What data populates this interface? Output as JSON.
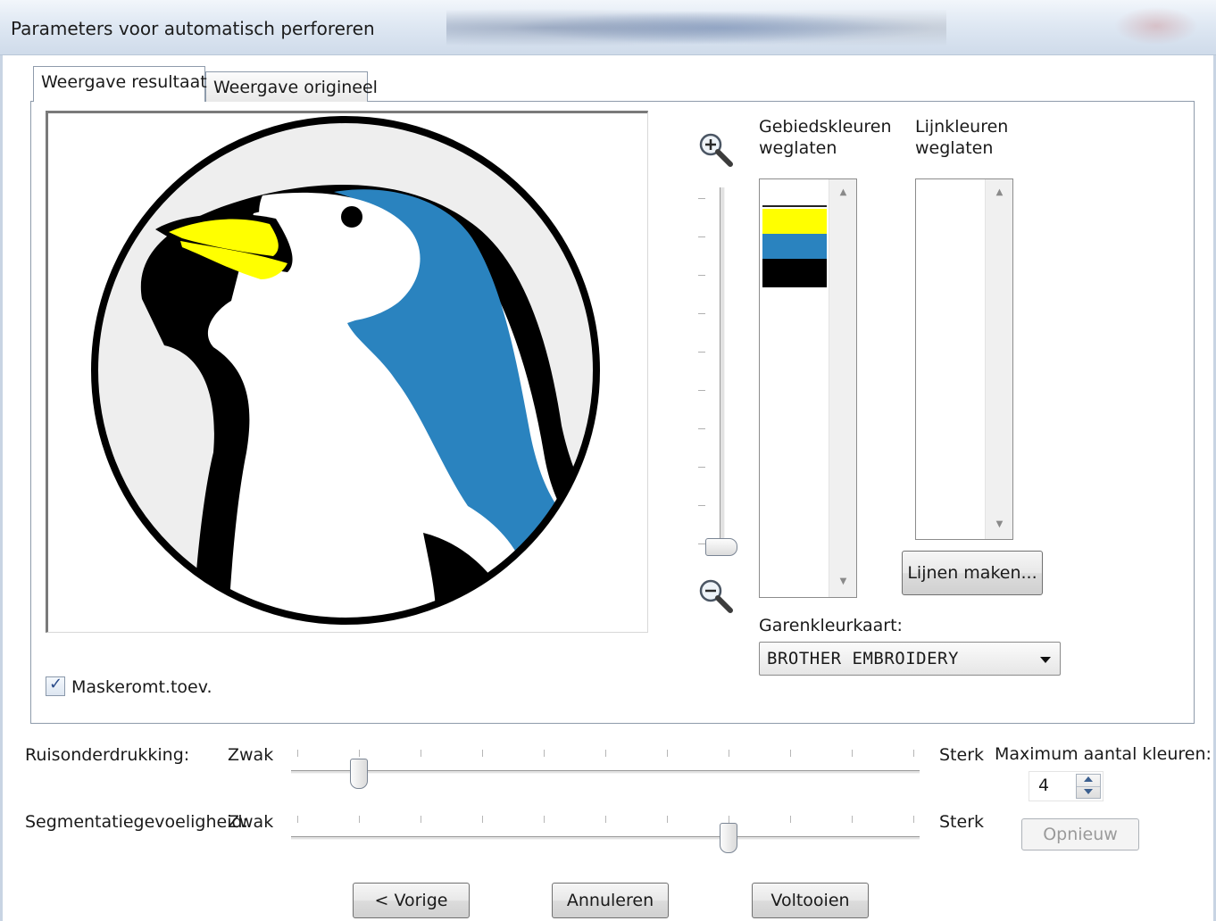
{
  "window": {
    "title": "Parameters voor automatisch perforeren"
  },
  "tabs": [
    {
      "label": "Weergave resultaat",
      "active": true
    },
    {
      "label": "Weergave origineel",
      "active": false
    }
  ],
  "preview": {
    "image": "penguin-head-illustration",
    "colors": {
      "blue": "#2a83bf",
      "yellow": "#ffff00",
      "black": "#000000",
      "white": "#ffffff",
      "background": "#eeeeee"
    }
  },
  "zoom": {
    "in_icon": "zoom-in-icon",
    "out_icon": "zoom-out-icon",
    "level": 0
  },
  "area_colors": {
    "label_line1": "Gebiedskleuren",
    "label_line2": "weglaten",
    "swatches": [
      "#ffffff",
      "#ffff00",
      "#2a83bf",
      "#000000"
    ]
  },
  "line_colors": {
    "label_line1": "Lijnkleuren",
    "label_line2": "weglaten",
    "items": []
  },
  "buttons": {
    "make_lines": "Lijnen maken...",
    "retry": "Opnieuw",
    "previous": "< Vorige",
    "cancel": "Annuleren",
    "finish": "Voltooien"
  },
  "thread_chart": {
    "label": "Garenkleurkaart:",
    "selected": "BROTHER EMBROIDERY"
  },
  "mask": {
    "label": "Maskeromt.toev.",
    "checked": true
  },
  "sliders": {
    "weak": "Zwak",
    "strong": "Sterk",
    "noise": {
      "label": "Ruisonderdrukking:",
      "value_fraction": 0.1
    },
    "segmentation": {
      "label": "Segmentatiegevoeligheid:",
      "value_fraction": 0.7
    }
  },
  "max_colors": {
    "label": "Maximum aantal kleuren:",
    "value": "4"
  }
}
